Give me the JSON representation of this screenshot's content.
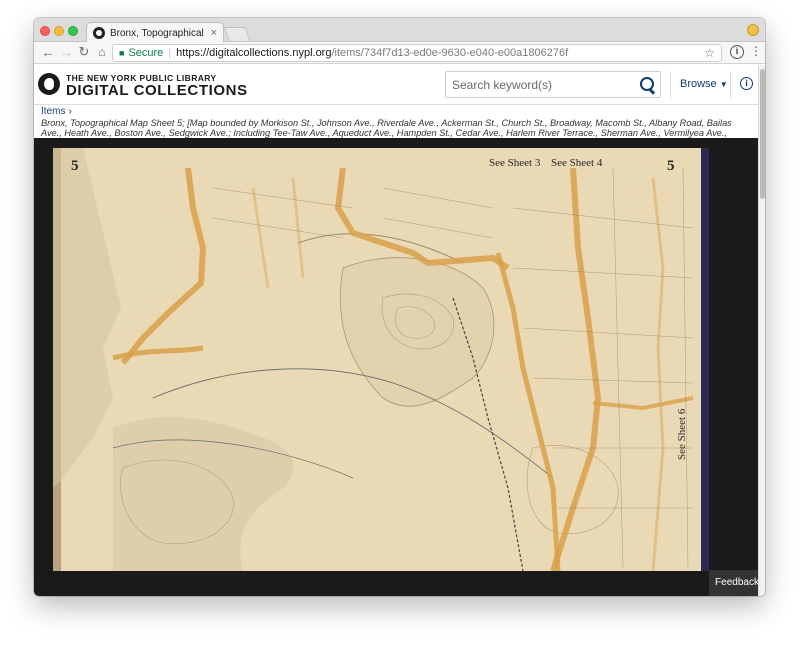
{
  "browser": {
    "tab_title": "Bronx, Topographical Map She",
    "tab_close": "×",
    "secure_label": "Secure",
    "url_host": "https://digitalcollections.nypl.org",
    "url_path": "/items/734f7d13-ed0e-9630-e040-e00a1806276f"
  },
  "site": {
    "logo_line1": "THE NEW YORK PUBLIC LIBRARY",
    "logo_line2": "DIGITAL COLLECTIONS",
    "search_placeholder": "Search keyword(s)",
    "browse_label": "Browse",
    "info_glyph": "i"
  },
  "breadcrumb": {
    "items_label": "Items",
    "title": "Bronx, Topographical Map Sheet 5; [Map bounded by Morkison St., Johnson Ave., Riverdale Ave., Ackerman St., Church St., Broadway, Macomb St., Albany Road, Bailas Ave., Heath Ave., Boston Ave., Sedgwick Ave.; Including Tee-Taw Ave., Aqueduct Ave., Hampden St., Cedar Ave., Harlem River Terrace., Sherman Ave., Vermilyea Ave., Kingsbridge Road, Academy St., Hudson River Railroad]"
  },
  "map": {
    "sheet_number_left": "5",
    "sheet_number_right": "5",
    "see_sheet_3": "See Sheet 3",
    "see_sheet_4": "See Sheet 4",
    "see_sheet_6": "See Sheet 6"
  },
  "viewer": {
    "feedback_label": "Feedback"
  },
  "colors": {
    "paper": "#e9d9b5",
    "road": "#d9a04a",
    "water": "#cfd9d8",
    "link": "#123a6b"
  }
}
